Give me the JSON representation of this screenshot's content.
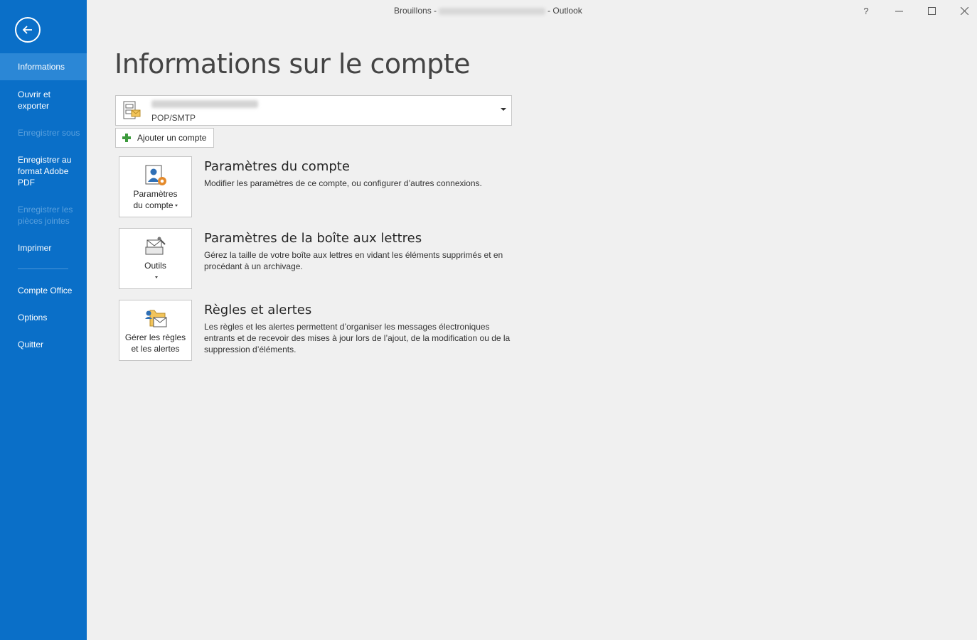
{
  "window": {
    "title_prefix": "Brouillons -",
    "title_suffix": "- Outlook",
    "help": "?",
    "minimize": "—",
    "maximize": "☐",
    "close": "✕"
  },
  "sidebar": {
    "back_icon": "back-arrow-icon",
    "items": [
      {
        "label": "Informations",
        "state": "active"
      },
      {
        "label": "Ouvrir et exporter",
        "state": "enabled"
      },
      {
        "label": "Enregistrer sous",
        "state": "disabled"
      },
      {
        "label": "Enregistrer au format Adobe PDF",
        "state": "enabled"
      },
      {
        "label": "Enregistrer les pièces jointes",
        "state": "disabled"
      },
      {
        "label": "Imprimer",
        "state": "enabled"
      },
      {
        "label": "Compte Office",
        "state": "enabled"
      },
      {
        "label": "Options",
        "state": "enabled"
      },
      {
        "label": "Quitter",
        "state": "enabled"
      }
    ],
    "colors": {
      "background": "#0a6fc8",
      "active": "#2b87d6",
      "disabled_text": "#5aa0dd"
    }
  },
  "main": {
    "title": "Informations sur le compte",
    "account": {
      "type": "POP/SMTP"
    },
    "add_account_label": "Ajouter un compte",
    "sections": [
      {
        "tile_label_1": "Paramètres",
        "tile_label_2": "du compte",
        "heading": "Paramètres du compte",
        "description": "Modifier les paramètres de ce compte, ou configurer d’autres connexions.",
        "icon": "account-settings-icon"
      },
      {
        "tile_label_1": "Outils",
        "tile_label_2": "",
        "heading": "Paramètres de la boîte aux lettres",
        "description": "Gérez la taille de votre boîte aux lettres en vidant les éléments supprimés et en procédant à un archivage.",
        "icon": "tools-icon"
      },
      {
        "tile_label_1": "Gérer les règles",
        "tile_label_2": "et les alertes",
        "heading": "Règles et alertes",
        "description": "Les règles et les alertes permettent d’organiser les messages électroniques entrants et de recevoir des mises à jour lors de l’ajout, de la modification ou de la suppression d’éléments.",
        "icon": "rules-alerts-icon"
      }
    ]
  }
}
